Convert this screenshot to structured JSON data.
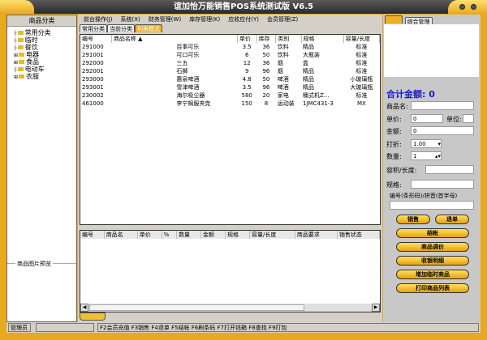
{
  "window": {
    "title": "谊加怡万能销售POS系统测试版 V6.5"
  },
  "left": {
    "header": "商品分类",
    "tree": [
      {
        "label": "常用分类",
        "expand": false
      },
      {
        "label": "临时",
        "expand": false
      },
      {
        "label": "餐饮",
        "expand": false
      },
      {
        "label": "电器",
        "expand": true
      },
      {
        "label": "食品",
        "expand": true
      },
      {
        "label": "电动车",
        "expand": false
      },
      {
        "label": "衣服",
        "expand": true
      }
    ],
    "preview_label": "商品图片预览"
  },
  "menu": [
    "前台操作(J)",
    "系统(X)",
    "财务管理(W)",
    "库存管理(K)",
    "应收应付(Y)",
    "会员管理(Z)"
  ],
  "tabs": [
    {
      "label": "常用分类",
      "active": false
    },
    {
      "label": "当前分类",
      "active": false
    },
    {
      "label": "列表模式",
      "active": true
    }
  ],
  "products": {
    "columns": [
      "编号",
      "商品名称 ▲",
      "单价",
      "库存",
      "类别",
      "规格",
      "容量/长度"
    ],
    "rows": [
      [
        "291000",
        "百事可乐",
        "3.5",
        "36",
        "饮料",
        "精品",
        "标准"
      ],
      [
        "291001",
        "可口可乐",
        "6",
        "50",
        "饮料",
        "大瓶装",
        "标准"
      ],
      [
        "292000",
        "三五",
        "12",
        "36",
        "烟",
        "盒",
        "标准"
      ],
      [
        "292001",
        "石狮",
        "9",
        "96",
        "烟",
        "精品",
        "标准"
      ],
      [
        "293000",
        "惠泉啤酒",
        "4.8",
        "50",
        "啤酒",
        "精品",
        "小玻璃瓶"
      ],
      [
        "293001",
        "雪津啤酒",
        "3.5",
        "96",
        "啤酒",
        "精品",
        "大玻璃瓶"
      ],
      [
        "230002",
        "海尔吸尘器",
        "580",
        "20",
        "家电",
        "桶式机Z...",
        "标准"
      ],
      [
        "461000",
        "李宁棉服夹克",
        "150",
        "8",
        "运动装",
        "1JMC431-3",
        "MX"
      ]
    ]
  },
  "cart": {
    "columns": [
      "编号",
      "商品名",
      "单价",
      "%",
      "数量",
      "金额",
      "规格",
      "容量/长度",
      "商品要求",
      "销售状态"
    ]
  },
  "right": {
    "tabs": [
      "",
      "综合管理"
    ],
    "total_label": "合计金额:",
    "total_value": "0",
    "name_label": "商品名:",
    "name_value": "",
    "price_label": "单价:",
    "price_value": "0",
    "unit_label": "单位:",
    "unit_value": "",
    "amount_label": "金额:",
    "amount_value": "0",
    "discount_label": "打折:",
    "discount_value": "1.00",
    "qty_label": "数量:",
    "qty_value": "1",
    "volume_label": "容积/长度:",
    "volume_value": "",
    "spec_label": "规格:",
    "spec_value": "",
    "code_label": "编号(条形码)/拼音(首字母)",
    "code_value": "",
    "buttons": {
      "sell": "销售",
      "return": "退单",
      "checkout": "结帐",
      "adjust": "商品调价",
      "details": "收银明细",
      "add_temp": "增加临时商品",
      "print": "打印商品列表"
    }
  },
  "status": {
    "user": "管理员",
    "blank": "",
    "hotkeys": "F2会员充值 F3销售 F4退单 F5结帐 F6刷条码 F7打开钱箱 F8查找 F9打包"
  },
  "colors": {
    "frame": "#e8a820",
    "button": "#f0b820",
    "total": "#1a1acc"
  }
}
